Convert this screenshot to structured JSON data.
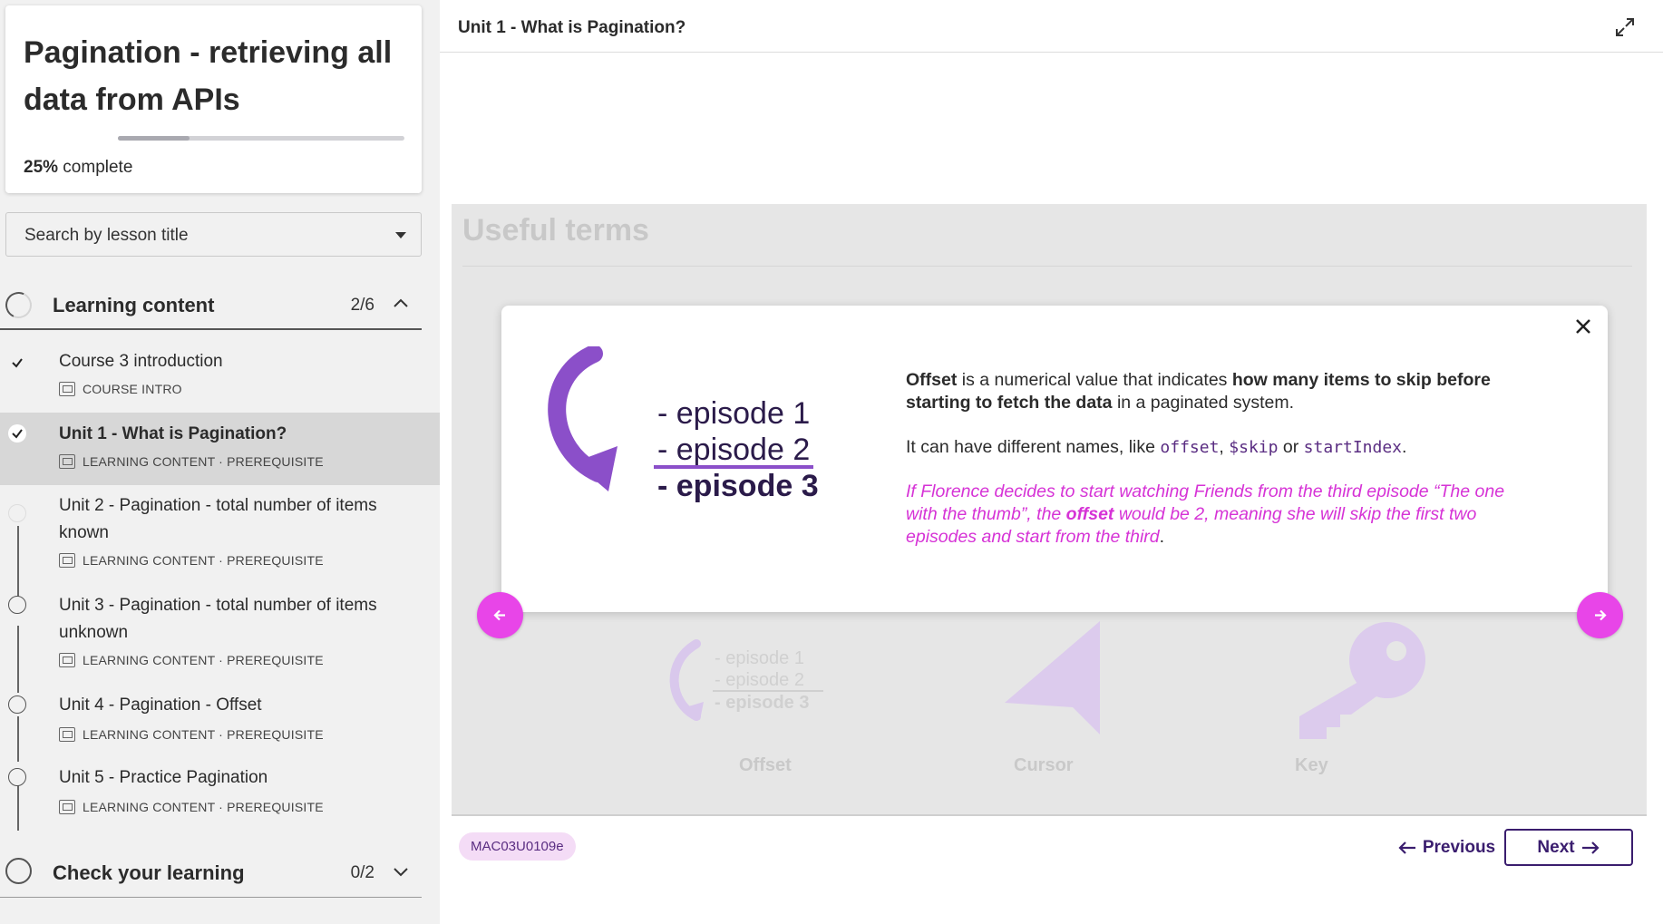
{
  "course": {
    "title": "Pagination - retrieving all data from APIs",
    "progress_percent": 25,
    "progress_pct_label": "25%",
    "progress_suffix": " complete"
  },
  "search": {
    "placeholder": "Search by lesson title"
  },
  "sections": [
    {
      "label": "Learning content",
      "count": "2/6",
      "expanded": true
    },
    {
      "label": "Check your learning",
      "count": "0/2",
      "expanded": false
    }
  ],
  "lessons": [
    {
      "title": "Course 3 introduction",
      "meta": "COURSE INTRO",
      "done": true,
      "active": false
    },
    {
      "title": "Unit 1 - What is Pagination?",
      "meta": "LEARNING CONTENT · PREREQUISITE",
      "done": true,
      "active": true
    },
    {
      "title": "Unit 2 - Pagination - total number of items known",
      "meta": "LEARNING CONTENT · PREREQUISITE",
      "done": false,
      "active": false
    },
    {
      "title": "Unit 3 - Pagination - total number of items unknown",
      "meta": "LEARNING CONTENT · PREREQUISITE",
      "done": false,
      "active": false
    },
    {
      "title": "Unit 4 - Pagination - Offset",
      "meta": "LEARNING CONTENT · PREREQUISITE",
      "done": false,
      "active": false
    },
    {
      "title": "Unit 5 - Practice Pagination",
      "meta": "LEARNING CONTENT · PREREQUISITE",
      "done": false,
      "active": false
    }
  ],
  "main": {
    "unit_title": "Unit 1 - What is Pagination?",
    "section_heading": "Useful terms",
    "background_terms": [
      "Offset",
      "Cursor",
      "Key"
    ],
    "illustration_episodes": [
      "- episode 1",
      "- episode 2",
      "- episode 3"
    ],
    "modal": {
      "p1_term": "Offset",
      "p1_a": " is a numerical value that indicates ",
      "p1_bold": "how many items to skip before starting to fetch the data",
      "p1_b": " in a paginated system.",
      "p2_a": "It can have different names, like ",
      "p2_code1": "offset",
      "p2_sep1": ", ",
      "p2_code2": "$skip",
      "p2_sep2": " or ",
      "p2_code3": "startIndex",
      "p2_end": ".",
      "p3_a": "If Florence decides to start watching Friends from the third episode “The one with the thumb”, the ",
      "p3_bold": "offset",
      "p3_b": " would be 2, meaning she will skip the first two episodes and start from the third",
      "p3_end": "."
    },
    "lesson_code": "MAC03U0109e",
    "prev_label": "Previous",
    "next_label": "Next"
  },
  "colors": {
    "accent_pink": "#e845e8",
    "accent_purple": "#3a1d6e",
    "illustration_purple": "#8b4fc9"
  }
}
